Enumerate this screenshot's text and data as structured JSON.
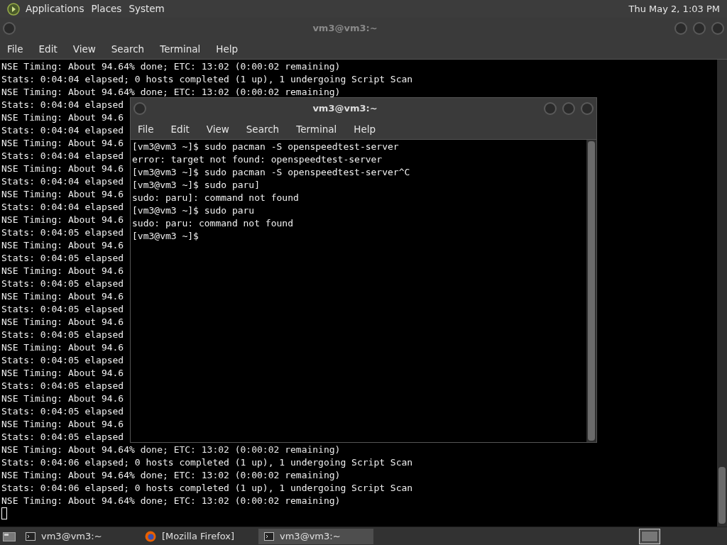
{
  "top_panel": {
    "menus": [
      "Applications",
      "Places",
      "System"
    ],
    "clock": "Thu May 2, 1:03 PM"
  },
  "back_window": {
    "title": "vm3@vm3:~",
    "menu": [
      "File",
      "Edit",
      "View",
      "Search",
      "Terminal",
      "Help"
    ],
    "lines": [
      "NSE Timing: About 94.64% done; ETC: 13:02 (0:00:02 remaining)",
      "Stats: 0:04:04 elapsed; 0 hosts completed (1 up), 1 undergoing Script Scan",
      "NSE Timing: About 94.64% done; ETC: 13:02 (0:00:02 remaining)",
      "Stats: 0:04:04 elapsed",
      "NSE Timing: About 94.6",
      "Stats: 0:04:04 elapsed",
      "NSE Timing: About 94.6",
      "Stats: 0:04:04 elapsed",
      "NSE Timing: About 94.6",
      "Stats: 0:04:04 elapsed",
      "NSE Timing: About 94.6",
      "Stats: 0:04:04 elapsed",
      "NSE Timing: About 94.6",
      "Stats: 0:04:05 elapsed",
      "NSE Timing: About 94.6",
      "Stats: 0:04:05 elapsed",
      "NSE Timing: About 94.6",
      "Stats: 0:04:05 elapsed",
      "NSE Timing: About 94.6",
      "Stats: 0:04:05 elapsed",
      "NSE Timing: About 94.6",
      "Stats: 0:04:05 elapsed",
      "NSE Timing: About 94.6",
      "Stats: 0:04:05 elapsed",
      "NSE Timing: About 94.6",
      "Stats: 0:04:05 elapsed",
      "NSE Timing: About 94.6",
      "Stats: 0:04:05 elapsed",
      "NSE Timing: About 94.6",
      "Stats: 0:04:05 elapsed",
      "NSE Timing: About 94.64% done; ETC: 13:02 (0:00:02 remaining)",
      "Stats: 0:04:06 elapsed; 0 hosts completed (1 up), 1 undergoing Script Scan",
      "NSE Timing: About 94.64% done; ETC: 13:02 (0:00:02 remaining)",
      "Stats: 0:04:06 elapsed; 0 hosts completed (1 up), 1 undergoing Script Scan",
      "NSE Timing: About 94.64% done; ETC: 13:02 (0:00:02 remaining)"
    ]
  },
  "front_window": {
    "title": "vm3@vm3:~",
    "menu": [
      "File",
      "Edit",
      "View",
      "Search",
      "Terminal",
      "Help"
    ],
    "lines": [
      "[vm3@vm3 ~]$ sudo pacman -S openspeedtest-server",
      "error: target not found: openspeedtest-server",
      "[vm3@vm3 ~]$ sudo pacman -S openspeedtest-server^C",
      "[vm3@vm3 ~]$ sudo paru]",
      "sudo: paru]: command not found",
      "[vm3@vm3 ~]$ sudo paru",
      "sudo: paru: command not found",
      "[vm3@vm3 ~]$"
    ]
  },
  "taskbar": {
    "items": [
      {
        "kind": "terminal",
        "label": "vm3@vm3:~",
        "selected": false
      },
      {
        "kind": "browser",
        "label": "[Mozilla Firefox]",
        "selected": false
      },
      {
        "kind": "terminal",
        "label": "vm3@vm3:~",
        "selected": true
      }
    ]
  }
}
